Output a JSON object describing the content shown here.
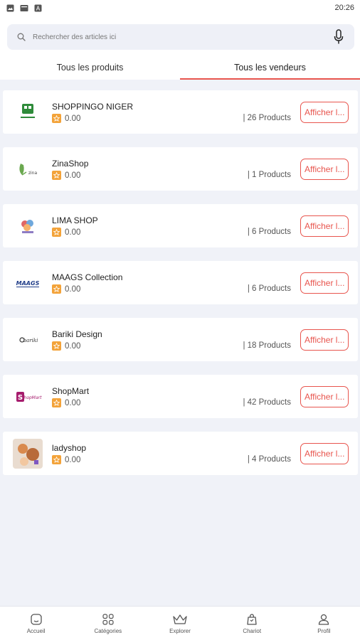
{
  "status_bar": {
    "time": "20:26",
    "icons": [
      "gallery-icon",
      "image-icon",
      "app-icon"
    ]
  },
  "search": {
    "placeholder": "Rechercher des articles ici",
    "icon": "search-icon",
    "mic_icon": "mic-icon"
  },
  "tabs": [
    {
      "label": "Tous les produits",
      "active": false
    },
    {
      "label": "Tous les vendeurs",
      "active": true
    }
  ],
  "vendors": [
    {
      "name": "SHOPPINGO NIGER",
      "rating": "0.00",
      "products": "| 26 Products",
      "button": "Afficher l..."
    },
    {
      "name": "ZinaShop",
      "rating": "0.00",
      "products": "| 1 Products",
      "button": "Afficher l..."
    },
    {
      "name": "LIMA SHOP",
      "rating": "0.00",
      "products": "| 6 Products",
      "button": "Afficher l..."
    },
    {
      "name": "MAAGS Collection",
      "rating": "0.00",
      "products": "| 6 Products",
      "button": "Afficher l..."
    },
    {
      "name": "Bariki Design",
      "rating": "0.00",
      "products": "| 18 Products",
      "button": "Afficher l..."
    },
    {
      "name": "ShopMart",
      "rating": "0.00",
      "products": "| 42 Products",
      "button": "Afficher l..."
    },
    {
      "name": "ladyshop",
      "rating": "0.00",
      "products": "| 4 Products",
      "button": "Afficher l..."
    }
  ],
  "bottom_nav": [
    {
      "label": "Accueil",
      "icon": "home-icon"
    },
    {
      "label": "Catégories",
      "icon": "categories-icon"
    },
    {
      "label": "Explorer",
      "icon": "crown-icon"
    },
    {
      "label": "Chariot",
      "icon": "cart-bag-icon"
    },
    {
      "label": "Profil",
      "icon": "user-icon"
    }
  ],
  "colors": {
    "accent": "#e8554e",
    "star": "#f3a33a",
    "background": "#f0f2f8"
  }
}
